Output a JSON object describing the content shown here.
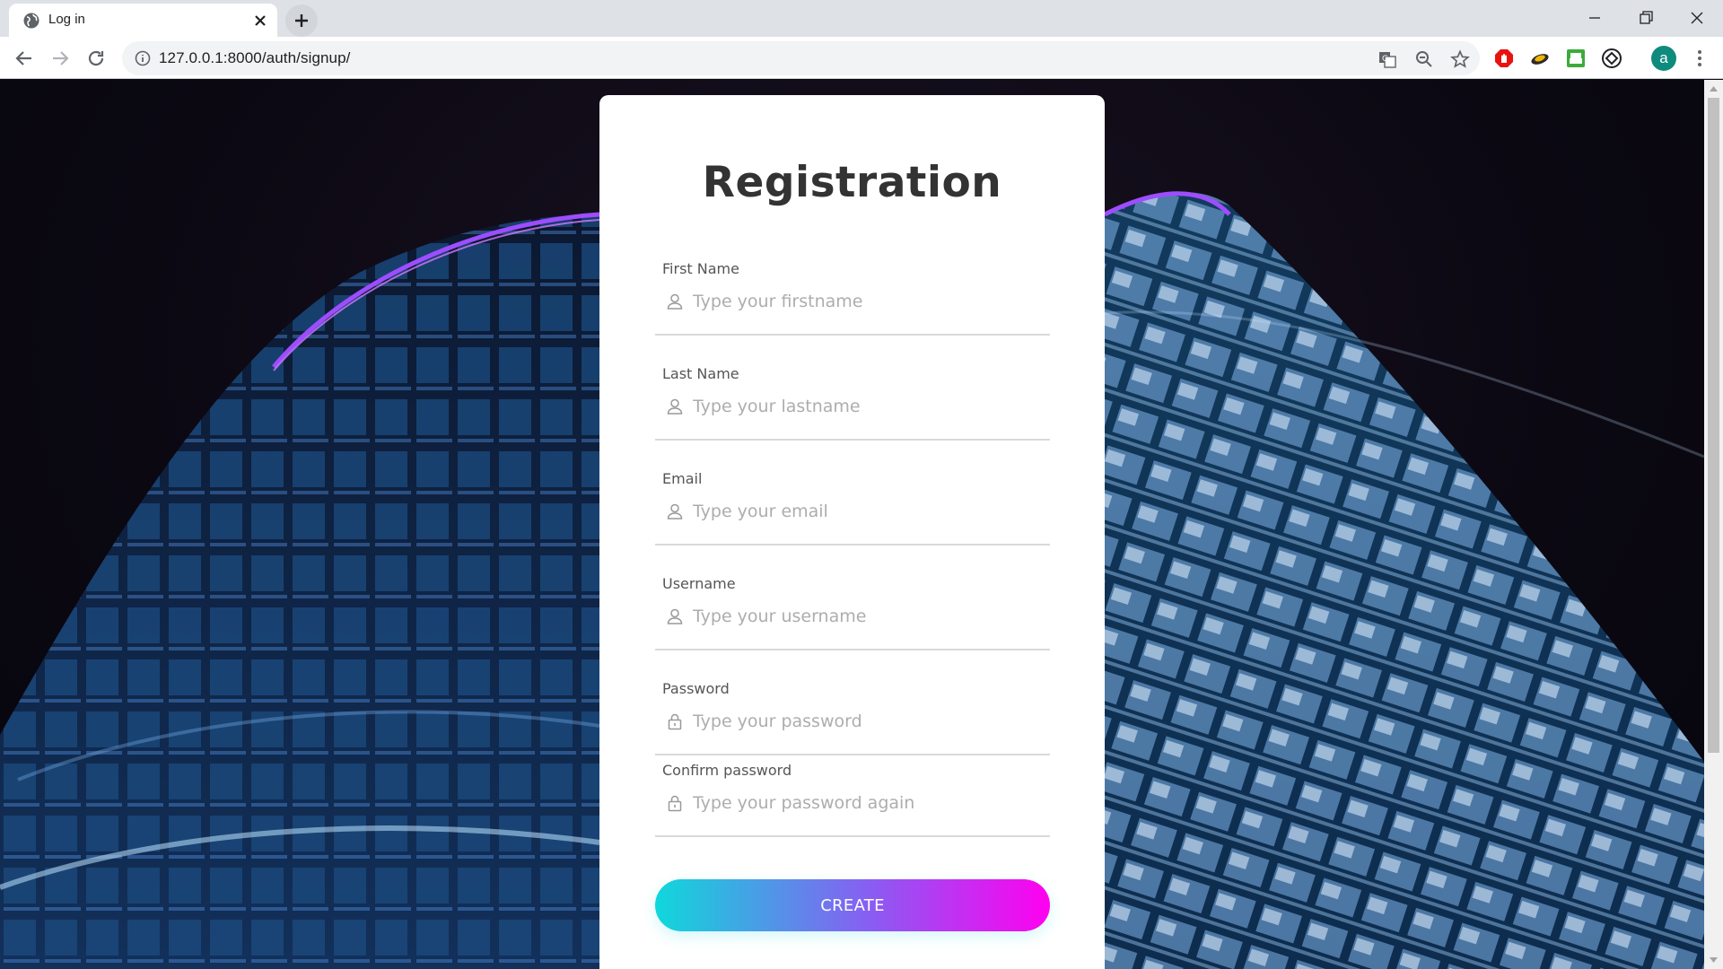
{
  "browser": {
    "tab_title": "Log in",
    "url": "127.0.0.1:8000/auth/signup/",
    "profile_initial": "a"
  },
  "icons": {
    "tab_favicon": "globe-icon",
    "tab_close": "close-icon",
    "new_tab": "plus-icon",
    "back": "arrow-left-icon",
    "forward": "arrow-right-icon",
    "reload": "reload-icon",
    "site_info": "info-icon",
    "translate": "translate-icon",
    "zoom": "zoom-out-icon",
    "bookmark": "star-icon",
    "menu": "kebab-menu-icon",
    "person": "user-icon",
    "lock": "lock-icon"
  },
  "form": {
    "title": "Registration",
    "fields": [
      {
        "label": "First Name",
        "placeholder": "Type your firstname",
        "icon": "user-icon"
      },
      {
        "label": "Last Name",
        "placeholder": "Type your lastname",
        "icon": "user-icon"
      },
      {
        "label": "Email",
        "placeholder": "Type your email",
        "icon": "user-icon"
      },
      {
        "label": "Username",
        "placeholder": "Type your username",
        "icon": "user-icon"
      },
      {
        "label": "Password",
        "placeholder": "Type your password",
        "icon": "lock-icon"
      },
      {
        "label": "Confirm password",
        "placeholder": "Type your password again",
        "icon": "lock-icon"
      }
    ],
    "submit_label": "CREATE"
  },
  "colors": {
    "button_gradient_start": "#0fd8db",
    "button_gradient_end": "#ff00f0",
    "card_background": "#ffffff",
    "title_color": "#333333"
  }
}
